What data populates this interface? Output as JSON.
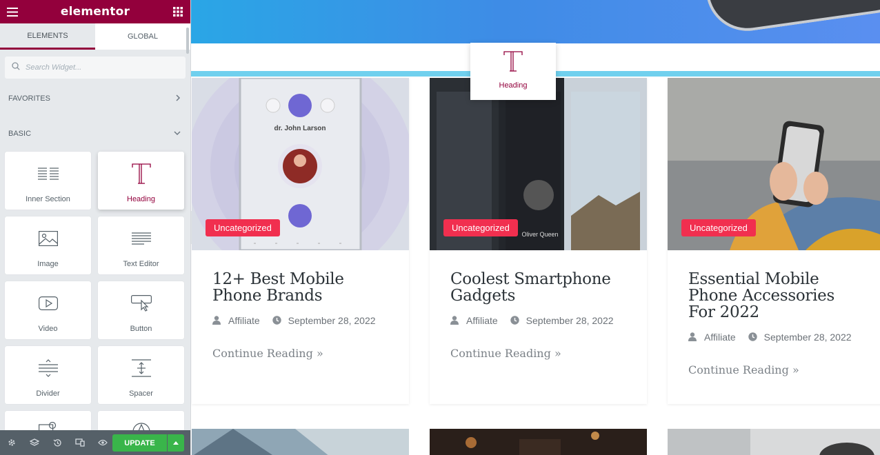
{
  "panel": {
    "logo": "elementor",
    "tabs": [
      {
        "label": "ELEMENTS",
        "active": true
      },
      {
        "label": "GLOBAL",
        "active": false
      }
    ],
    "search_placeholder": "Search Widget...",
    "sections": {
      "favorites": "FAVORITES",
      "basic": "BASIC"
    },
    "widgets": [
      {
        "label": "Inner Section",
        "icon": "inner-section-icon"
      },
      {
        "label": "Heading",
        "icon": "heading-icon",
        "selected": true
      },
      {
        "label": "Image",
        "icon": "image-icon"
      },
      {
        "label": "Text Editor",
        "icon": "text-editor-icon"
      },
      {
        "label": "Video",
        "icon": "video-icon"
      },
      {
        "label": "Button",
        "icon": "button-icon"
      },
      {
        "label": "Divider",
        "icon": "divider-icon"
      },
      {
        "label": "Spacer",
        "icon": "spacer-icon"
      }
    ],
    "footer": {
      "update_label": "UPDATE"
    },
    "colors": {
      "brand": "#93003c",
      "update": "#39b54a",
      "footer": "#556068"
    }
  },
  "drag_widget": {
    "label": "Heading"
  },
  "posts": [
    {
      "category": "Uncategorized",
      "title": "12+ Best Mobile Phone Brands",
      "author": "Affiliate",
      "date": "September 28, 2022",
      "more": "Continue Reading »",
      "img_text": "dr. John Larson"
    },
    {
      "category": "Uncategorized",
      "title": "Coolest Smartphone Gadgets",
      "author": "Affiliate",
      "date": "September 28, 2022",
      "more": "Continue Reading »",
      "img_text": "Oliver Queen"
    },
    {
      "category": "Uncategorized",
      "title": "Essential Mobile Phone Accessories For 2022",
      "author": "Affiliate",
      "date": "September 28, 2022",
      "more": "Continue Reading »"
    }
  ],
  "accent": {
    "badge": "#f12f4f",
    "drop_line": "#70d0ee"
  }
}
